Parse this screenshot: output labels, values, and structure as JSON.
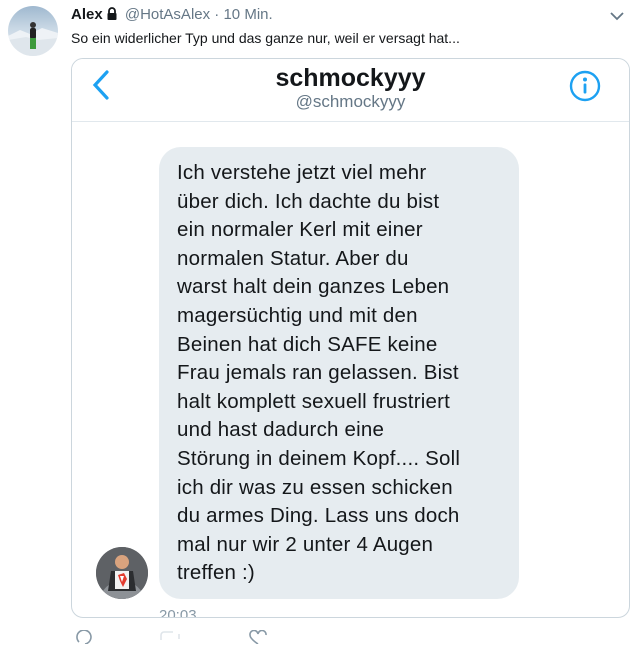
{
  "tweet": {
    "name": "Alex",
    "handle": "@HotAsAlex",
    "separator": "·",
    "time": "10 Min.",
    "text": "So ein widerlicher Typ und das ganze nur, weil er versagt hat..."
  },
  "dm": {
    "contact_name": "schmockyyy",
    "contact_handle": "@schmockyyy",
    "message": "Ich verstehe jetzt viel mehr\nüber dich. Ich dachte du bist\nein normaler Kerl mit einer\nnormalen Statur. Aber du\nwarst halt dein ganzes Leben\nmagersüchtig und mit den\nBeinen hat dich SAFE keine\nFrau jemals ran gelassen. Bist\nhalt komplett sexuell frustriert\nund hast dadurch eine\nStörung in deinem Kopf.... Soll\nich dir was zu essen schicken\ndu armes Ding. Lass uns doch\nmal nur wir 2 unter 4 Augen\ntreffen :)",
    "message_time": "20:03"
  },
  "colors": {
    "accent": "#1da1f2",
    "bubble": "#e6ecf0",
    "muted": "#657786"
  },
  "icons": [
    "lock-icon",
    "chevron-down-icon",
    "back-chevron-icon",
    "info-icon",
    "reply-icon",
    "retweet-icon",
    "like-icon"
  ]
}
